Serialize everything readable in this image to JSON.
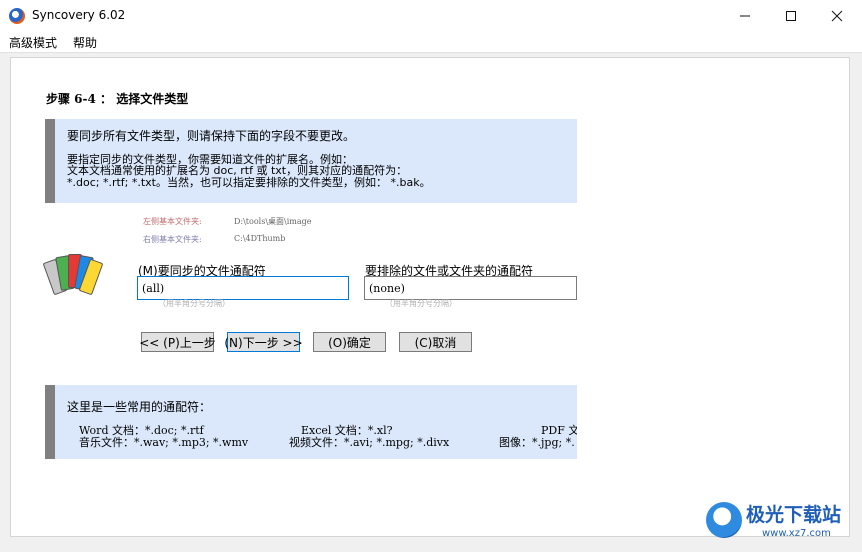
{
  "window": {
    "title": "Syncovery 6.02",
    "minimize_icon": "minimize-icon",
    "maximize_icon": "maximize-icon",
    "close_icon": "close-icon"
  },
  "menu": {
    "items": [
      "高级模式",
      "帮助"
    ]
  },
  "step": {
    "title": "步骤 6-4 ： 选择文件类型"
  },
  "info": {
    "line0": "要同步所有文件类型，则请保持下面的字段不要更改。",
    "line1": "要指定同步的文件类型，你需要知道文件的扩展名。例如：",
    "line2": "文本文档通常使用的扩展名为 doc, rtf 或 txt，则其对应的通配符为：",
    "line3": "*.doc; *.rtf; *.txt。当然，也可以指定要排除的文件类型，例如： *.bak。"
  },
  "folders": {
    "left_label": "左侧基本文件夹:",
    "left_path": "D:\\tools\\桌面\\image",
    "right_label": "右侧基本文件夹:",
    "right_path": "C:\\4DThumb"
  },
  "filters": {
    "include_label": "(M)要同步的文件通配符",
    "include_value": "(all)",
    "include_hint": "（用半角分号分隔）",
    "exclude_label": "要排除的文件或文件夹的通配符",
    "exclude_value": "(none)",
    "exclude_hint": "（用半角分号分隔）"
  },
  "buttons": {
    "prev": "<< (P)上一步",
    "next": "(N)下一步 >>",
    "ok": "(O)确定",
    "cancel": "(C)取消"
  },
  "common": {
    "title": "这里是一些常用的通配符：",
    "word": "Word 文档：*.doc; *.rtf",
    "excel": "Excel 文档：*.xl?",
    "pdf": "PDF 文档",
    "music": "音乐文件：*.wav; *.mp3; *.wmv",
    "video": "视频文件：*.avi; *.mpg; *.divx",
    "image": "图像：*.jpg; *."
  },
  "watermark": {
    "text": "极光下载站",
    "url": "www.xz7.com"
  },
  "colors": {
    "info_bg": "#dbe8fb",
    "info_bar": "#808080",
    "focus_border": "#0078d7"
  }
}
